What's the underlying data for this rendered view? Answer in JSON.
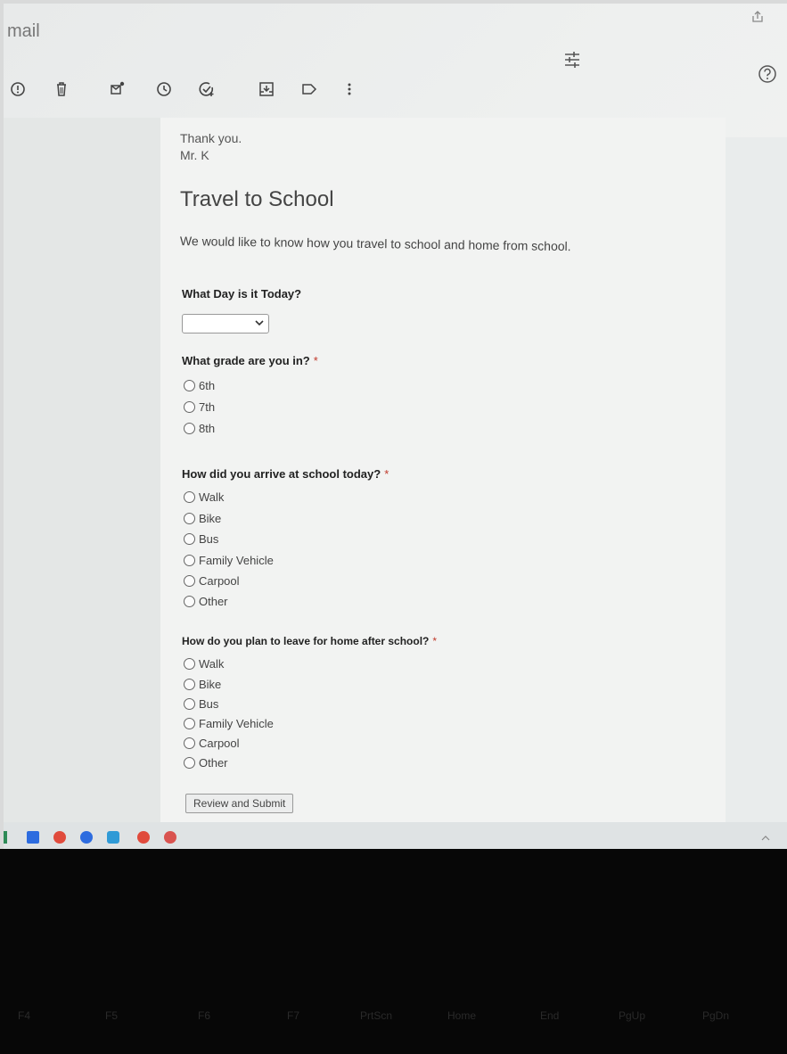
{
  "app": {
    "name": "mail"
  },
  "toolbar": {
    "icons": [
      "report-icon",
      "delete-icon",
      "mark-unread-icon",
      "snooze-icon",
      "add-task-icon",
      "move-to-icon",
      "label-icon",
      "more-icon"
    ]
  },
  "email": {
    "thanks": "Thank you.",
    "signature": "Mr. K"
  },
  "form": {
    "title": "Travel to School",
    "description": "We would like to know how you travel to school and home from school.",
    "q1": {
      "label": "What Day is it Today?",
      "value": ""
    },
    "q2": {
      "label": "What grade are you in?",
      "required": "*",
      "options": [
        "6th",
        "7th",
        "8th"
      ]
    },
    "q3": {
      "label": "How did you arrive at school today?",
      "required": "*",
      "options": [
        "Walk",
        "Bike",
        "Bus",
        "Family Vehicle",
        "Carpool",
        "Other"
      ]
    },
    "q4": {
      "label": "How do you plan to leave for home after school?",
      "required": "*",
      "options": [
        "Walk",
        "Bike",
        "Bus",
        "Family Vehicle",
        "Carpool",
        "Other"
      ]
    },
    "submit_label": "Review and Submit"
  },
  "keyboard": {
    "keys": [
      "F4",
      "F5",
      "F6",
      "F7",
      "PrtScn",
      "Home",
      "End",
      "PgUp",
      "PgDn"
    ]
  },
  "colors": {
    "required": "#c0392b",
    "taskbar_chrome": "#e04b3c",
    "taskbar_zoom": "#2d6cdf"
  }
}
